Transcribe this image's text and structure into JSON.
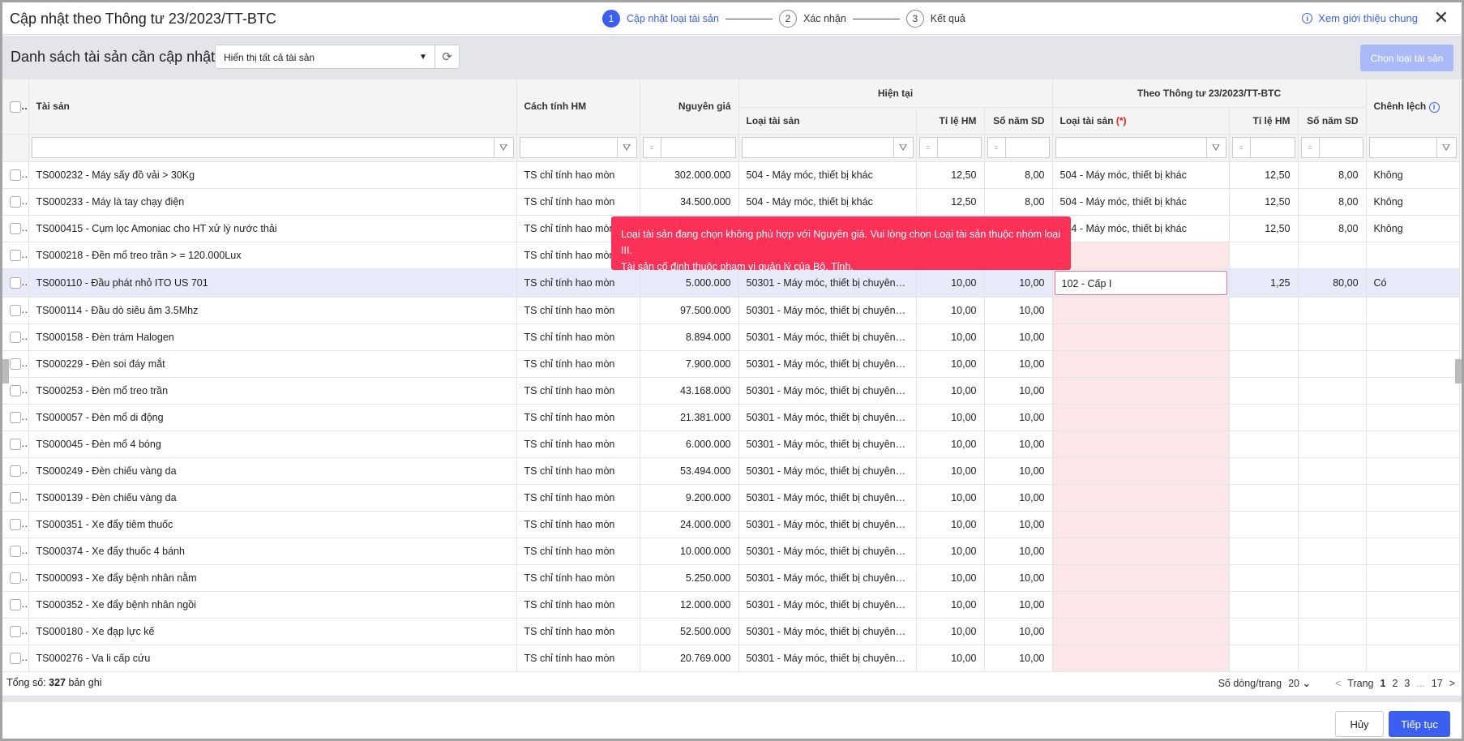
{
  "title": "Cập nhật theo Thông tư 23/2023/TT-BTC",
  "steps": [
    {
      "num": "1",
      "label": "Cập nhật loại tài sản"
    },
    {
      "num": "2",
      "label": "Xác nhận"
    },
    {
      "num": "3",
      "label": "Kết quả"
    }
  ],
  "intro_link": "Xem giới thiệu chung",
  "toolbar": {
    "title": "Danh sách tài sản cần cập nhật",
    "filter_value": "Hiển thị tất cả tài sản",
    "choose_button": "Chọn loại tài sản"
  },
  "columns": {
    "asset": "Tài sản",
    "method": "Cách tính HM",
    "cost": "Nguyên giá",
    "current_group": "Hiện tại",
    "tt_group": "Theo Thông tư 23/2023/TT-BTC",
    "type": "Loại tài sản",
    "rate": "Tỉ lệ HM",
    "years": "Số năm SD",
    "required_mark": "(*)",
    "diff": "Chênh lệch",
    "eq": "="
  },
  "tooltip": {
    "line1": "Loại tài sản đang chọn không phù hợp với Nguyên giá. Vui lòng chọn Loại tài sản thuộc nhóm loại III.",
    "line2": "Tài sản cố định thuộc phạm vi quản lý của Bộ, Tỉnh."
  },
  "rows": [
    {
      "asset": "TS000232 - Máy sấy đồ vải > 30Kg",
      "method": "TS chỉ tính hao mòn",
      "cost": "302.000.000",
      "type": "504 - Máy móc, thiết bị khác",
      "rate": "12,50",
      "years": "8,00",
      "new_type": "504 - Máy móc, thiết bị khác",
      "new_rate": "12,50",
      "new_years": "8,00",
      "diff": "Không"
    },
    {
      "asset": "TS000233 - Máy là tay chạy điện",
      "method": "TS chỉ tính hao mòn",
      "cost": "34.500.000",
      "type": "504 - Máy móc, thiết bị khác",
      "rate": "12,50",
      "years": "8,00",
      "new_type": "504 - Máy móc, thiết bị khác",
      "new_rate": "12,50",
      "new_years": "8,00",
      "diff": "Không"
    },
    {
      "asset": "TS000415 - Cụm lọc Amoniac cho HT xử lý nước thải",
      "method": "TS chỉ tính hao mòn",
      "cost": "",
      "type": "",
      "rate": "",
      "years": "",
      "new_type": "504 - Máy móc, thiết bị khác",
      "new_rate": "12,50",
      "new_years": "8,00",
      "diff": "Không"
    },
    {
      "asset": "TS000218 - Đền mổ treo trần > = 120.000Lux",
      "method": "TS chỉ tính hao mòn",
      "cost": "",
      "type": "",
      "rate": "",
      "years": "",
      "new_type": "",
      "new_rate": "",
      "new_years": "",
      "diff": ""
    },
    {
      "asset": "TS000110 - Đầu phát nhỏ ITO US 701",
      "method": "TS chỉ tính hao mòn",
      "cost": "5.000.000",
      "type": "50301 - Máy móc, thiết bị chuyên dùng",
      "rate": "10,00",
      "years": "10,00",
      "new_type": "102 - Cấp I",
      "new_rate": "1,25",
      "new_years": "80,00",
      "diff": "Có",
      "selected": true
    },
    {
      "asset": "TS000114 - Đầu dò siêu âm 3.5Mhz",
      "method": "TS chỉ tính hao mòn",
      "cost": "97.500.000",
      "type": "50301 - Máy móc, thiết bị chuyên dùng",
      "rate": "10,00",
      "years": "10,00",
      "new_type": "",
      "new_rate": "",
      "new_years": "",
      "diff": ""
    },
    {
      "asset": "TS000158 - Đèn trám Halogen",
      "method": "TS chỉ tính hao mòn",
      "cost": "8.894.000",
      "type": "50301 - Máy móc, thiết bị chuyên dùng",
      "rate": "10,00",
      "years": "10,00",
      "new_type": "",
      "new_rate": "",
      "new_years": "",
      "diff": ""
    },
    {
      "asset": "TS000229 - Đèn soi đáy mắt",
      "method": "TS chỉ tính hao mòn",
      "cost": "7.900.000",
      "type": "50301 - Máy móc, thiết bị chuyên dùng",
      "rate": "10,00",
      "years": "10,00",
      "new_type": "",
      "new_rate": "",
      "new_years": "",
      "diff": ""
    },
    {
      "asset": "TS000253 - Đèn mổ treo trần",
      "method": "TS chỉ tính hao mòn",
      "cost": "43.168.000",
      "type": "50301 - Máy móc, thiết bị chuyên dùng",
      "rate": "10,00",
      "years": "10,00",
      "new_type": "",
      "new_rate": "",
      "new_years": "",
      "diff": ""
    },
    {
      "asset": "TS000057 - Đèn mổ di động",
      "method": "TS chỉ tính hao mòn",
      "cost": "21.381.000",
      "type": "50301 - Máy móc, thiết bị chuyên dùng",
      "rate": "10,00",
      "years": "10,00",
      "new_type": "",
      "new_rate": "",
      "new_years": "",
      "diff": ""
    },
    {
      "asset": "TS000045 - Đèn mổ 4 bóng",
      "method": "TS chỉ tính hao mòn",
      "cost": "6.000.000",
      "type": "50301 - Máy móc, thiết bị chuyên dùng",
      "rate": "10,00",
      "years": "10,00",
      "new_type": "",
      "new_rate": "",
      "new_years": "",
      "diff": ""
    },
    {
      "asset": "TS000249 - Đèn chiếu vàng da",
      "method": "TS chỉ tính hao mòn",
      "cost": "53.494.000",
      "type": "50301 - Máy móc, thiết bị chuyên dùng",
      "rate": "10,00",
      "years": "10,00",
      "new_type": "",
      "new_rate": "",
      "new_years": "",
      "diff": ""
    },
    {
      "asset": "TS000139 - Đèn chiếu vàng da",
      "method": "TS chỉ tính hao mòn",
      "cost": "9.200.000",
      "type": "50301 - Máy móc, thiết bị chuyên dùng",
      "rate": "10,00",
      "years": "10,00",
      "new_type": "",
      "new_rate": "",
      "new_years": "",
      "diff": ""
    },
    {
      "asset": "TS000351 - Xe đẩy tiêm thuốc",
      "method": "TS chỉ tính hao mòn",
      "cost": "24.000.000",
      "type": "50301 - Máy móc, thiết bị chuyên dùng",
      "rate": "10,00",
      "years": "10,00",
      "new_type": "",
      "new_rate": "",
      "new_years": "",
      "diff": ""
    },
    {
      "asset": "TS000374 - Xe đẩy thuốc 4 bánh",
      "method": "TS chỉ tính hao mòn",
      "cost": "10.000.000",
      "type": "50301 - Máy móc, thiết bị chuyên dùng",
      "rate": "10,00",
      "years": "10,00",
      "new_type": "",
      "new_rate": "",
      "new_years": "",
      "diff": ""
    },
    {
      "asset": "TS000093 - Xe đẩy bệnh nhân nằm",
      "method": "TS chỉ tính hao mòn",
      "cost": "5.250.000",
      "type": "50301 - Máy móc, thiết bị chuyên dùng",
      "rate": "10,00",
      "years": "10,00",
      "new_type": "",
      "new_rate": "",
      "new_years": "",
      "diff": ""
    },
    {
      "asset": "TS000352 - Xe đẩy bệnh nhân ngồi",
      "method": "TS chỉ tính hao mòn",
      "cost": "12.000.000",
      "type": "50301 - Máy móc, thiết bị chuyên dùng",
      "rate": "10,00",
      "years": "10,00",
      "new_type": "",
      "new_rate": "",
      "new_years": "",
      "diff": ""
    },
    {
      "asset": "TS000180 - Xe đạp lực kế",
      "method": "TS chỉ tính hao mòn",
      "cost": "52.500.000",
      "type": "50301 - Máy móc, thiết bị chuyên dùng",
      "rate": "10,00",
      "years": "10,00",
      "new_type": "",
      "new_rate": "",
      "new_years": "",
      "diff": ""
    },
    {
      "asset": "TS000276 - Va li cấp cứu",
      "method": "TS chỉ tính hao mòn",
      "cost": "20.769.000",
      "type": "50301 - Máy móc, thiết bị chuyên dùng",
      "rate": "10,00",
      "years": "10,00",
      "new_type": "",
      "new_rate": "",
      "new_years": "",
      "diff": ""
    }
  ],
  "footer": {
    "total_prefix": "Tổng số:",
    "total_count": "327",
    "total_suffix": "bản ghi",
    "page_size_label": "Số dòng/trang",
    "page_size": "20",
    "page_label": "Trang",
    "pages": [
      "1",
      "2",
      "3",
      "...",
      "17"
    ],
    "prev": "<",
    "next": ">"
  },
  "buttons": {
    "cancel": "Hủy",
    "next": "Tiếp tục"
  }
}
